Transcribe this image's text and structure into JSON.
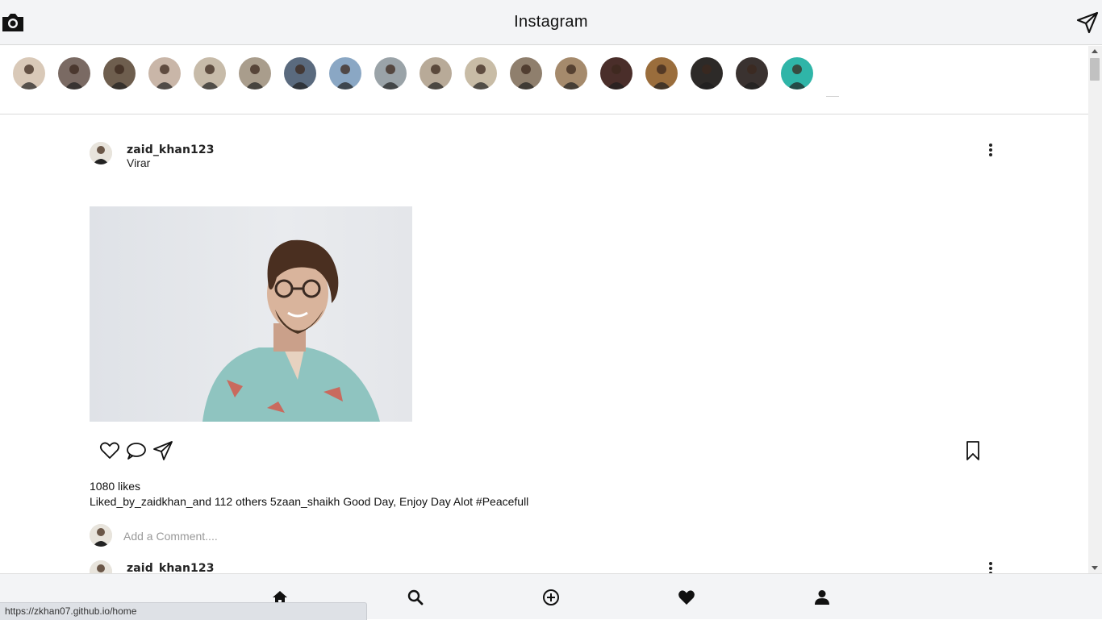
{
  "header": {
    "title": "Instagram",
    "camera_icon": "camera-icon",
    "send_icon": "paper-plane-icon"
  },
  "stories": [
    {
      "user": "story-1",
      "color": "#d9c9b8"
    },
    {
      "user": "story-2",
      "color": "#7a6a63"
    },
    {
      "user": "story-3",
      "color": "#6e5e4e"
    },
    {
      "user": "story-4",
      "color": "#c9b6a8"
    },
    {
      "user": "story-5",
      "color": "#c7bba9"
    },
    {
      "user": "story-6",
      "color": "#a99d8c"
    },
    {
      "user": "story-7",
      "color": "#5a6a7e"
    },
    {
      "user": "story-8",
      "color": "#8aa7c4"
    },
    {
      "user": "story-9",
      "color": "#9aa3a8"
    },
    {
      "user": "story-10",
      "color": "#b8aa98"
    },
    {
      "user": "story-11",
      "color": "#c8bca6"
    },
    {
      "user": "story-12",
      "color": "#8f7f6d"
    },
    {
      "user": "story-13",
      "color": "#a58a6c"
    },
    {
      "user": "story-14",
      "color": "#4a2e2a"
    },
    {
      "user": "story-15",
      "color": "#9a6d3c"
    },
    {
      "user": "story-16",
      "color": "#2d2a28"
    },
    {
      "user": "story-17",
      "color": "#3a3230"
    },
    {
      "user": "story-18",
      "color": "#2fb5a8"
    }
  ],
  "posts": [
    {
      "username": "zaid_khan123",
      "location": "Virar",
      "likes": "1080 likes",
      "caption": "Liked_by_zaidkhan_and 112 others 5zaan_shaikh Good Day, Enjoy Day Alot #Peacefull",
      "comment_placeholder": "Add a Comment...."
    },
    {
      "username": "zaid_khan123"
    }
  ],
  "bottom_nav": [
    "home-icon",
    "search-icon",
    "add-icon",
    "heart-icon",
    "profile-icon"
  ],
  "status_url": "https://zkhan07.github.io/home"
}
